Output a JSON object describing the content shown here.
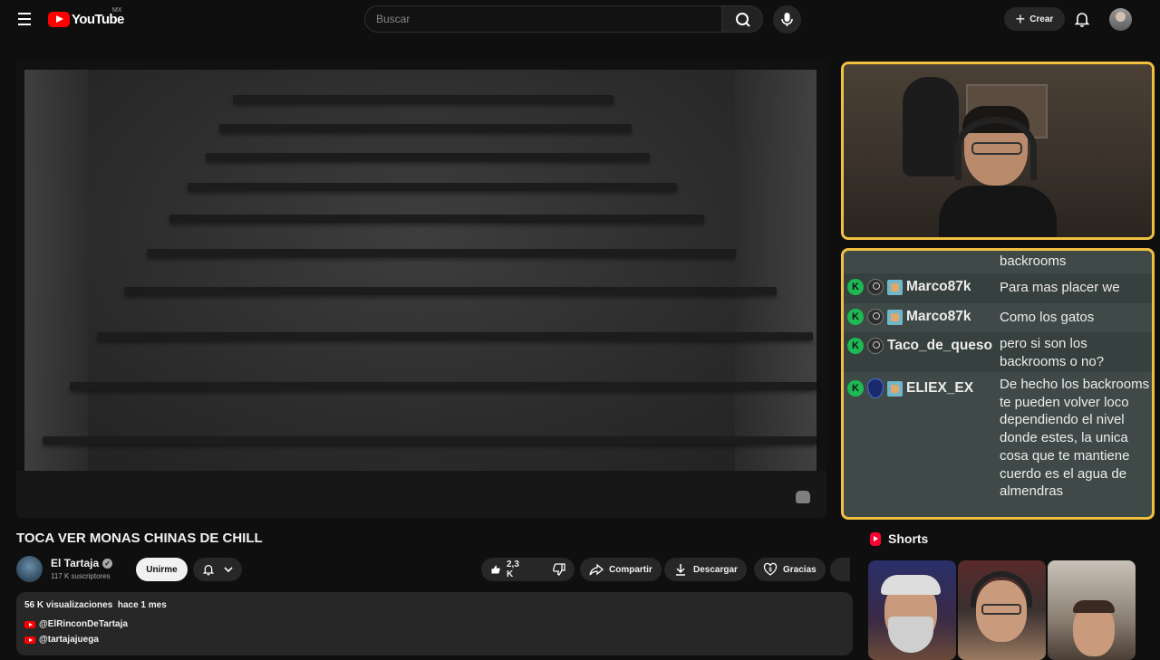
{
  "header": {
    "logo_text": "YouTube",
    "country_code": "MX",
    "search_placeholder": "Buscar",
    "create_label": "Crear"
  },
  "video": {
    "title": "TOCA VER MONAS CHINAS DE CHILL",
    "channel": {
      "name": "El Tartaja",
      "subscribers": "117 K suscriptores",
      "join_label": "Unirme"
    },
    "actions": {
      "likes": "2,3 K",
      "share_label": "Compartir",
      "download_label": "Descargar",
      "thanks_label": "Gracias"
    },
    "description": {
      "views": "56 K visualizaciones",
      "date": "hace 1 mes",
      "links": [
        "@ElRinconDeTartaja",
        "@tartajajuega"
      ]
    }
  },
  "chat_overlay": {
    "messages": [
      {
        "author": "",
        "text": "backrooms"
      },
      {
        "author": "Marco87k",
        "text": "Para mas placer we"
      },
      {
        "author": "Marco87k",
        "text": "Como los gatos"
      },
      {
        "author": "Taco_de_queso",
        "text": "pero si son los backrooms o no?"
      },
      {
        "author": "ELIEX_EX",
        "text": "De hecho los backrooms te pueden volver loco dependiendo el nivel donde estes, la unica cosa que te mantiene cuerdo es el agua de almendras"
      }
    ]
  },
  "shorts": {
    "label": "Shorts"
  }
}
